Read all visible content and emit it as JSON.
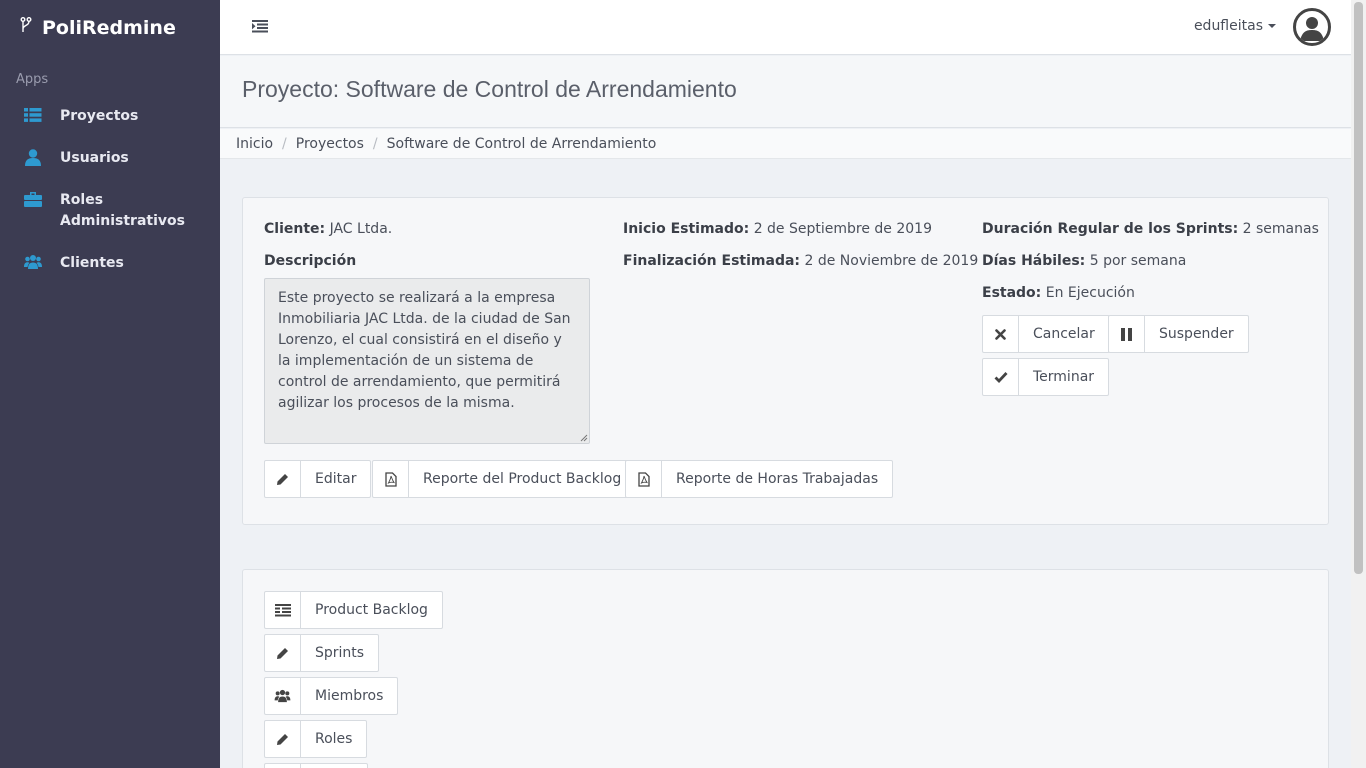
{
  "app": {
    "brand": "PoliRedmine"
  },
  "sidebar": {
    "section_label": "Apps",
    "items": [
      {
        "label": "Proyectos",
        "icon": "list-icon"
      },
      {
        "label": "Usuarios",
        "icon": "user-icon"
      },
      {
        "label": "Roles Administrativos",
        "icon": "briefcase-icon"
      },
      {
        "label": "Clientes",
        "icon": "users-icon"
      }
    ]
  },
  "topbar": {
    "username": "edufleitas"
  },
  "page": {
    "title": "Proyecto: Software de Control de Arrendamiento"
  },
  "breadcrumb": [
    "Inicio",
    "Proyectos",
    "Software de Control de Arrendamiento"
  ],
  "project": {
    "cliente_label": "Cliente:",
    "cliente": "JAC Ltda.",
    "descripcion_label": "Descripción",
    "descripcion": "Este proyecto se realizará a la empresa Inmobiliaria JAC Ltda. de la ciudad de San Lorenzo, el cual consistirá en el diseño y la implementación de un sistema de control de arrendamiento, que permitirá agilizar los procesos de la misma.",
    "inicio_label": "Inicio Estimado:",
    "inicio": "2 de Septiembre de 2019",
    "fin_label": "Finalización Estimada:",
    "fin": "2 de Noviembre de 2019",
    "duracion_label": "Duración Regular de los Sprints:",
    "duracion": "2 semanas",
    "dias_label": "Días Hábiles:",
    "dias": "5 por semana",
    "estado_label": "Estado:",
    "estado": "En Ejecución"
  },
  "actions": {
    "cancelar": "Cancelar",
    "suspender": "Suspender",
    "terminar": "Terminar",
    "editar": "Editar",
    "reporte_backlog": "Reporte del Product Backlog",
    "reporte_horas": "Reporte de Horas Trabajadas"
  },
  "modules": {
    "product_backlog": "Product Backlog",
    "sprints": "Sprints",
    "miembros": "Miembros",
    "roles": "Roles"
  },
  "colors": {
    "sidebar_bg": "#3c3c52",
    "accent": "#2e9ad0"
  }
}
